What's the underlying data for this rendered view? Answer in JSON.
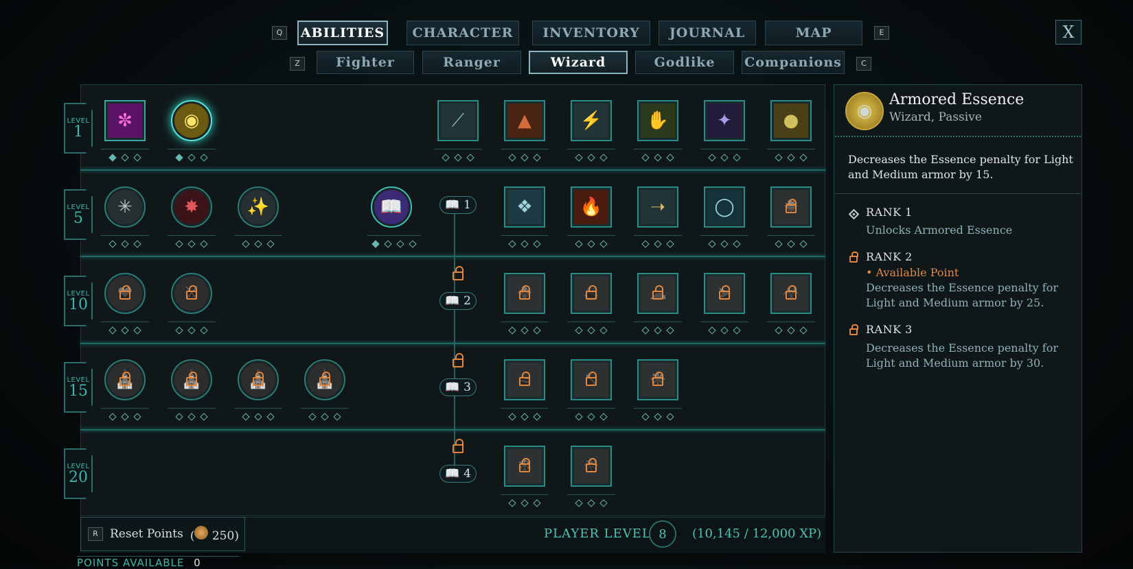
{
  "top_tabs": {
    "left_key": "Q",
    "right_key": "E",
    "items": [
      "ABILITIES",
      "CHARACTER",
      "INVENTORY",
      "JOURNAL",
      "MAP"
    ],
    "active": "ABILITIES"
  },
  "sub_tabs": {
    "left_key": "Z",
    "right_key": "C",
    "items": [
      "Fighter",
      "Ranger",
      "Wizard",
      "Godlike",
      "Companions"
    ],
    "active": "Wizard"
  },
  "close_label": "X",
  "levels": [
    {
      "word": "LEVEL",
      "num": "1"
    },
    {
      "word": "LEVEL",
      "num": "5"
    },
    {
      "word": "LEVEL",
      "num": "10"
    },
    {
      "word": "LEVEL",
      "num": "15"
    },
    {
      "word": "LEVEL",
      "num": "20"
    }
  ],
  "level_requirements": [
    "1",
    "2",
    "3",
    "4"
  ],
  "footer": {
    "reset_key": "R",
    "reset_label": "Reset Points",
    "reset_cost": "250",
    "player_level_label": "PLAYER LEVEL",
    "player_level": "8",
    "xp": "(10,145 / 12,000 XP)",
    "points_available_label": "POINTS AVAILABLE",
    "points_available": "0"
  },
  "detail": {
    "title": "Armored Essence",
    "subtitle": "Wizard, Passive",
    "description": "Decreases the Essence penalty for Light and Medium armor by 15.",
    "ranks": [
      {
        "title": "RANK 1",
        "note": "",
        "text": "Unlocks Armored Essence"
      },
      {
        "title": "RANK 2",
        "note": "• Available Point",
        "text": "Decreases the Essence penalty for Light and Medium armor by 25."
      },
      {
        "title": "RANK 3",
        "note": "",
        "text": "Decreases the Essence penalty for Light and Medium armor by 30."
      }
    ]
  },
  "colors": {
    "accent_teal": "#3fb7ad",
    "lock_orange": "#e2873c",
    "panel_bg": "#101719"
  }
}
